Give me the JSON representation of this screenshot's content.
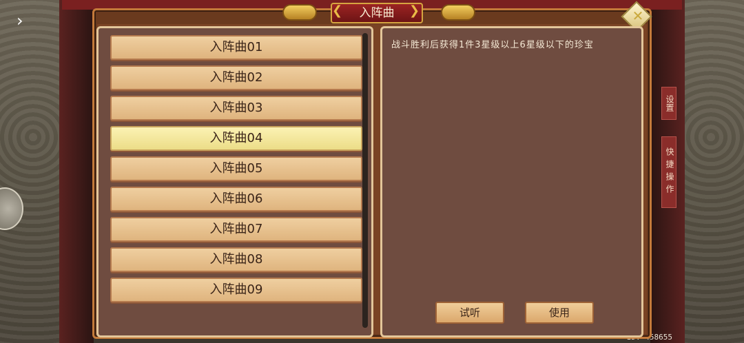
{
  "dialog": {
    "title": "入阵曲",
    "close_icon": "close-icon"
  },
  "songs": [
    "入阵曲01",
    "入阵曲02",
    "入阵曲03",
    "入阵曲04",
    "入阵曲05",
    "入阵曲06",
    "入阵曲07",
    "入阵曲08",
    "入阵曲09"
  ],
  "selected_index": 3,
  "description": "战斗胜利后获得1件3星级以上6星级以下的珍宝",
  "buttons": {
    "listen": "试听",
    "use": "使用"
  },
  "side_tabs": {
    "settings": "设置",
    "quick_ops": "快捷操作"
  },
  "footer": {
    "id_text": "ID: 458655"
  },
  "colors": {
    "item_bg": "#dfb47e",
    "item_selected_bg": "#ecdd88",
    "panel_bg": "#6f4c40",
    "title_banner": "#9c2423"
  }
}
